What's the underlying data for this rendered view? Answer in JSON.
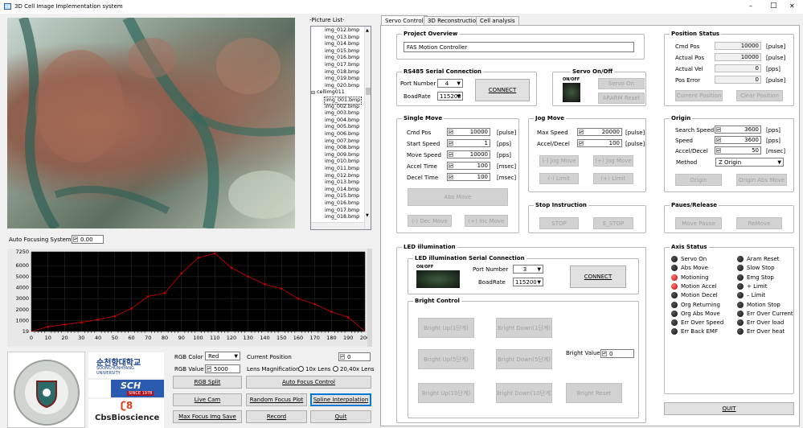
{
  "window": {
    "title": "3D Cell Image Implementation system",
    "minimize": "–",
    "maximize": "□",
    "close": "✕"
  },
  "picture_list": {
    "title": "-Picture List-",
    "items": [
      "img_012.bmp",
      "img_013.bmp",
      "img_014.bmp",
      "img_015.bmp",
      "img_016.bmp",
      "img_017.bmp",
      "img_018.bmp",
      "img_019.bmp",
      "img_020.bmp",
      "cellimg011",
      "img_001.bmp",
      "img_002.bmp",
      "img_003.bmp",
      "img_004.bmp",
      "img_005.bmp",
      "img_006.bmp",
      "img_007.bmp",
      "img_008.bmp",
      "img_009.bmp",
      "img_010.bmp",
      "img_011.bmp",
      "img_012.bmp",
      "img_013.bmp",
      "img_014.bmp",
      "img_015.bmp",
      "img_016.bmp",
      "img_017.bmp",
      "img_018.bmp"
    ]
  },
  "autofocus": {
    "label": "Auto Focusing System",
    "value": "0.00"
  },
  "chart_data": {
    "type": "line",
    "x": [
      10,
      20,
      30,
      40,
      50,
      60,
      70,
      80,
      90,
      100,
      110,
      120,
      130,
      140,
      150,
      160,
      170,
      180,
      190
    ],
    "values": [
      450,
      650,
      850,
      1100,
      1400,
      2100,
      3200,
      3500,
      5300,
      6700,
      7100,
      5800,
      5000,
      4300,
      3900,
      3000,
      2500,
      1800,
      1300
    ],
    "xticks": [
      "0",
      "10",
      "20",
      "30",
      "40",
      "50",
      "60",
      "70",
      "80",
      "90",
      "100",
      "110",
      "120",
      "130",
      "140",
      "150",
      "160",
      "170",
      "180",
      "190",
      "200"
    ],
    "yticks": [
      "19",
      "1000",
      "2000",
      "3000",
      "4000",
      "5000",
      "6000",
      "7250"
    ],
    "xlim": [
      0,
      200
    ],
    "ylim": [
      19,
      7250
    ],
    "grid": true
  },
  "controls": {
    "rgb_color_label": "RGB Color",
    "rgb_color_value": "Red",
    "rgb_value_label": "RGB Value",
    "rgb_value": "5000",
    "current_position_label": "Current Position",
    "current_position_value": "0",
    "lens_mag_label": "Lens Magnification",
    "lens_10x": "10x Lens",
    "lens_20x": "20,40x Lens",
    "rgb_split": "RGB Split",
    "auto_focus": "Auto Focus Control",
    "live_cam": "Live Cam",
    "random_focus": "Random Focus Plot",
    "spline": "Spline Interpolation",
    "max_focus": "Max Focus Img Save",
    "record": "Record",
    "quit": "Quit"
  },
  "logos": {
    "univ_kr": "순천향대학교",
    "univ_en": "SOONCHUNHYANG UNIVERSITY",
    "sch": "SCH",
    "since": "SINCE 1978",
    "cbs": "CbsBioscience",
    "seal": "SOON CHUN HYANG UNIVERSITY"
  },
  "tabs": [
    "Servo Control",
    "3D Reconstruction",
    "Cell analysis"
  ],
  "project": {
    "title": "Project Overview",
    "value": "FAS Motion Controller"
  },
  "rs485": {
    "title": "RS485 Serial Connection",
    "port_label": "Port Number",
    "port_value": "4",
    "baud_label": "BoadRate",
    "baud_value": "115200",
    "connect": "CONNECT"
  },
  "servo": {
    "title": "Servo On/Off",
    "onoff": "ON/OFF",
    "servo_on": "Servo On",
    "alarm_reset": "ARARM Reset"
  },
  "single_move": {
    "title": "Single Move",
    "rows": [
      {
        "label": "Cmd Pos",
        "value": "10000",
        "unit": "[pulse]"
      },
      {
        "label": "Start Speed",
        "value": "1",
        "unit": "[pps]"
      },
      {
        "label": "Move Speed",
        "value": "10000",
        "unit": "[pps]"
      },
      {
        "label": "Accel Time",
        "value": "100",
        "unit": "[msec]"
      },
      {
        "label": "Decel Time",
        "value": "100",
        "unit": "[msec]"
      }
    ],
    "abs_move": "Abs Move",
    "dec_move": "(-) Dec Move",
    "inc_move": "(+) Inc Move"
  },
  "jog_move": {
    "title": "Jog Move",
    "rows": [
      {
        "label": "Max Speed",
        "value": "20000",
        "unit": "[pulse]"
      },
      {
        "label": "Accel/Decel",
        "value": "100",
        "unit": "[pulse]"
      }
    ],
    "jog_minus": "(-) Jog Move",
    "jog_plus": "(+) Jog Move",
    "limit_minus": "(-) Limit",
    "limit_plus": "(+) Limit"
  },
  "stop": {
    "title": "Stop Instruction",
    "stop": "STOP",
    "estop": "E_STOP"
  },
  "position_status": {
    "title": "Position Status",
    "rows": [
      {
        "label": "Cmd Pos",
        "value": "10000",
        "unit": "[pulse]"
      },
      {
        "label": "Actual Pos",
        "value": "10000",
        "unit": "[pulse]"
      },
      {
        "label": "Actual Vel",
        "value": "0",
        "unit": "[pps]"
      },
      {
        "label": "Pos Error",
        "value": "0",
        "unit": "[pulse]"
      }
    ],
    "current_position": "Current Position",
    "clear_position": "Clear Position"
  },
  "origin": {
    "title": "Origin",
    "rows": [
      {
        "label": "Search Speed",
        "value": "3600",
        "unit": "[pps]"
      },
      {
        "label": "Speed",
        "value": "3600",
        "unit": "[pps]"
      },
      {
        "label": "Accel/Decel",
        "value": "50",
        "unit": "[msec]"
      }
    ],
    "method_label": "Method",
    "method_value": "Z Origin",
    "origin_btn": "Origin",
    "origin_abs": "Origin Abs Move"
  },
  "pause": {
    "title": "Paues/Release",
    "move_pause": "Move Pause",
    "remove": "ReMove"
  },
  "led": {
    "title": "LED illumination",
    "serial_title": "LED illumination Serial Connection",
    "onoff": "ON/OFF",
    "port_label": "Port Number",
    "port_value": "3",
    "baud_label": "BoadRate",
    "baud_value": "115200",
    "connect": "CONNECT",
    "bright_title": "Bright Control",
    "up1": "Bright Up(1단계)",
    "down1": "Bright Down(1단계)",
    "up5": "Bright Up(5단계)",
    "down5": "Bright Down(5단계)",
    "up10": "Bright Up(10단계)",
    "down10": "Bright Down(10단계)",
    "bright_value_label": "Bright Value",
    "bright_value": "0",
    "reset": "Bright Reset"
  },
  "axis_status": {
    "title": "Axis Status",
    "left": [
      {
        "label": "Servo On",
        "on": false
      },
      {
        "label": "Abs Move",
        "on": false
      },
      {
        "label": "Motioning",
        "on": true
      },
      {
        "label": "Motion Accel",
        "on": true
      },
      {
        "label": "Motion Decel",
        "on": false
      },
      {
        "label": "Org Returning",
        "on": false
      },
      {
        "label": "Org Abs Move",
        "on": false
      },
      {
        "label": "Err Over Speed",
        "on": false
      },
      {
        "label": "Err Back EMF",
        "on": false
      }
    ],
    "right": [
      {
        "label": "Aram Reset",
        "on": false
      },
      {
        "label": "Slow Stop",
        "on": false
      },
      {
        "label": "Emg Stop",
        "on": false
      },
      {
        "label": "+ Limit",
        "on": false
      },
      {
        "label": "– Limit",
        "on": false
      },
      {
        "label": "Motion Stop",
        "on": false
      },
      {
        "label": "Err Over Current",
        "on": false
      },
      {
        "label": "Err Over load",
        "on": false
      },
      {
        "label": "Err Over heat",
        "on": false
      }
    ],
    "quit": "QUIT"
  },
  "colors": {
    "accent": "#0078d7",
    "led_red": "#e02020",
    "plot_bg": "#000000",
    "plot_line": "#c00000"
  }
}
